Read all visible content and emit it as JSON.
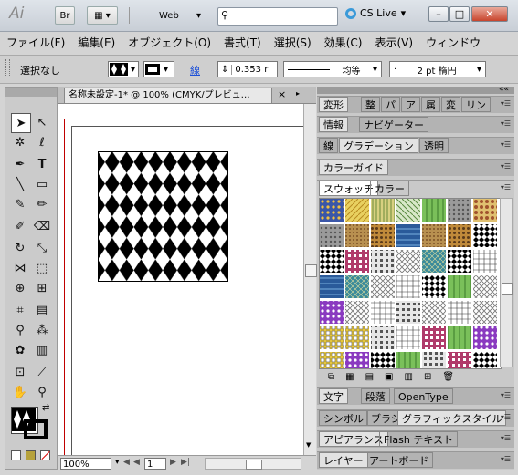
{
  "app": {
    "logo": "Ai",
    "br": "Br",
    "workspace": "Web",
    "cslive": "CS Live"
  },
  "window": {
    "minimize": "–",
    "restore": "□",
    "close": "✕"
  },
  "menu": [
    "ファイル(F)",
    "編集(E)",
    "オブジェクト(O)",
    "書式(T)",
    "選択(S)",
    "効果(C)",
    "表示(V)",
    "ウィンドウ"
  ],
  "control": {
    "selection": "選択なし",
    "stroke_label": "線",
    "stroke_weight": "0.353 r",
    "stroke_style": "均等",
    "brush": "2 pt 楕円"
  },
  "document": {
    "tab_title": "名称未設定-1* @ 100% (CMYK/プレビュ…",
    "tab_close": "×",
    "zoom": "100%",
    "page": "1"
  },
  "panels": {
    "row1": [
      "変形",
      "整",
      "パ",
      "ア",
      "属",
      "変",
      "リン"
    ],
    "row2": [
      "情報",
      "ナビゲーター"
    ],
    "row3": [
      "線",
      "グラデーション",
      "透明"
    ],
    "row4": [
      "カラーガイド"
    ],
    "row5": [
      "スウォッチ",
      "カラー"
    ],
    "row6": [
      "文字",
      "段落",
      "OpenType"
    ],
    "row7": [
      "シンボル",
      "ブラシ",
      "グラフィックスタイル"
    ],
    "row8": [
      "アピアランス",
      "Flash テキスト"
    ],
    "row9": [
      "レイヤー",
      "アートボード"
    ]
  },
  "colors": {
    "accent": "#5a9bd4",
    "chrome": "#d4d4d4",
    "artboard_border": "#c00000"
  },
  "icons": {
    "close": "close-icon",
    "search": "search-icon",
    "panel_menu": "panel-menu-icon"
  }
}
